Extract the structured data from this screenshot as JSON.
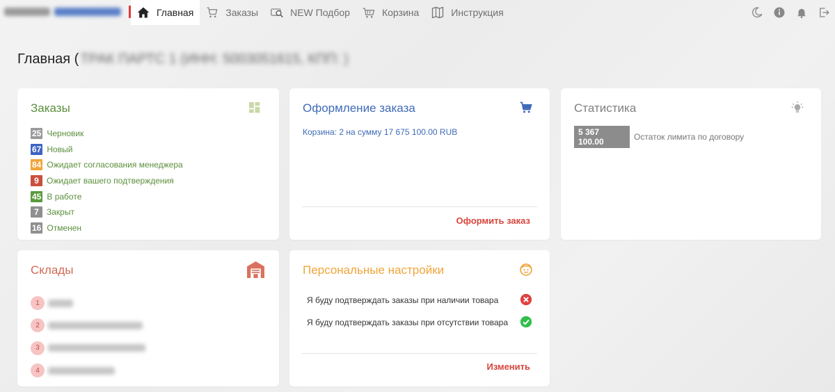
{
  "nav": {
    "items": [
      {
        "label": "Главная",
        "icon": "home-icon",
        "active": true
      },
      {
        "label": "Заказы",
        "icon": "cart-icon",
        "active": false
      },
      {
        "label": "NEW Подбор",
        "icon": "car-search-icon",
        "active": false
      },
      {
        "label": "Корзина",
        "icon": "basket-icon",
        "active": false
      },
      {
        "label": "Инструкция",
        "icon": "book-icon",
        "active": false
      }
    ],
    "right_icons": [
      "moon-icon",
      "info-icon",
      "bell-icon",
      "logout-icon"
    ]
  },
  "page": {
    "title": "Главная (",
    "company_blurred": "ТРАК ПАРТС 1 (ИНН: 5003051615, КПП: )"
  },
  "orders": {
    "title": "Заказы",
    "icon": "dashboard-grid-icon",
    "statuses": [
      {
        "count": "25",
        "label": "Черновик",
        "color": "#9a9a9a"
      },
      {
        "count": "67",
        "label": "Новый",
        "color": "#3e64c2"
      },
      {
        "count": "84",
        "label": "Ожидает согласования менеджера",
        "color": "#f0a53a"
      },
      {
        "count": "9",
        "label": "Ожидает вашего подтверждения",
        "color": "#c9503f"
      },
      {
        "count": "45",
        "label": "В работе",
        "color": "#5b9a3d"
      },
      {
        "count": "7",
        "label": "Закрыт",
        "color": "#8f8f8f"
      },
      {
        "count": "16",
        "label": "Отменен",
        "color": "#8f8f8f"
      }
    ]
  },
  "checkout": {
    "title": "Оформление заказа",
    "cart_summary": "Корзина: 2 на сумму 17 675 100.00 RUB",
    "action": "Оформить заказ"
  },
  "stats": {
    "title": "Статистика",
    "limit_value": "5 367 100.00",
    "limit_label": "Остаток лимита по договору"
  },
  "warehouses": {
    "title": "Склады",
    "items": [
      {
        "num": "1",
        "name_blurred": "FDBm"
      },
      {
        "num": "2",
        "name_blurred": "СДмлвФрунзе запчасти"
      },
      {
        "num": "3",
        "name_blurred": "Склад дилерских деталей"
      },
      {
        "num": "4",
        "name_blurred": "Фрунзе запчасти"
      }
    ]
  },
  "settings": {
    "title": "Персональные настройки",
    "prefs": [
      {
        "label": "Я буду подтверждать заказы при наличии товара",
        "state": "off"
      },
      {
        "label": "Я буду подтверждать заказы при отсутствии товара",
        "state": "on"
      }
    ],
    "action": "Изменить"
  },
  "colors": {
    "orders_title": "#5b8f3c",
    "checkout_title": "#3f6bb8",
    "stats_title": "#808080",
    "warehouses_title": "#d06a55",
    "settings_title": "#f0a53a",
    "accent_red": "#d8453c"
  }
}
